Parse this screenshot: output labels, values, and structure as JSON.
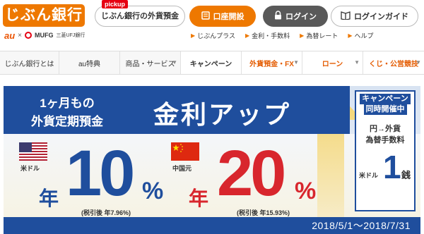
{
  "header": {
    "logo": "じぶん銀行",
    "partner_au": "au",
    "partner_x": "×",
    "partner_mufg": "MUFG",
    "partner_ufj": "三菱UFJ銀行",
    "pickup_tag": "pickup",
    "pickup_label": "じぶん銀行の外貨預金",
    "open_account": "口座開設",
    "login": "ログイン",
    "login_guide": "ログインガイド",
    "sublinks": [
      "じぶんプラス",
      "金利・手数料",
      "為替レート",
      "ヘルプ"
    ]
  },
  "nav": {
    "items": [
      {
        "label": "じぶん銀行とは"
      },
      {
        "label": "au特典"
      },
      {
        "label": "商品・サービス"
      },
      {
        "label": "キャンペーン"
      },
      {
        "label": "外貨預金・FX"
      },
      {
        "label": "ローン"
      },
      {
        "label": "くじ・公営競技"
      }
    ]
  },
  "banner": {
    "left_line1": "1ヶ月もの",
    "left_line2": "外貨定期預金",
    "title": "金利アップ",
    "usd": {
      "flag_label": "米ドル",
      "prefix": "年",
      "rate": "10",
      "pct": "%",
      "tax_note": "(税引後 年7.96%)"
    },
    "cny": {
      "flag_label": "中国元",
      "prefix": "年",
      "rate": "20",
      "pct": "%",
      "tax_note": "(税引後 年15.93%)"
    },
    "campaign": {
      "head1": "キャンペーン",
      "head2": "同時開催中",
      "line3": "円→外貨",
      "line4": "為替手数料",
      "usd_label": "米ドル",
      "value": "1",
      "unit": "銭"
    },
    "period": "2018/5/1～2018/7/31"
  },
  "colors": {
    "brand_orange": "#ee7800",
    "navy": "#1f4e9d",
    "red": "#e60012"
  }
}
